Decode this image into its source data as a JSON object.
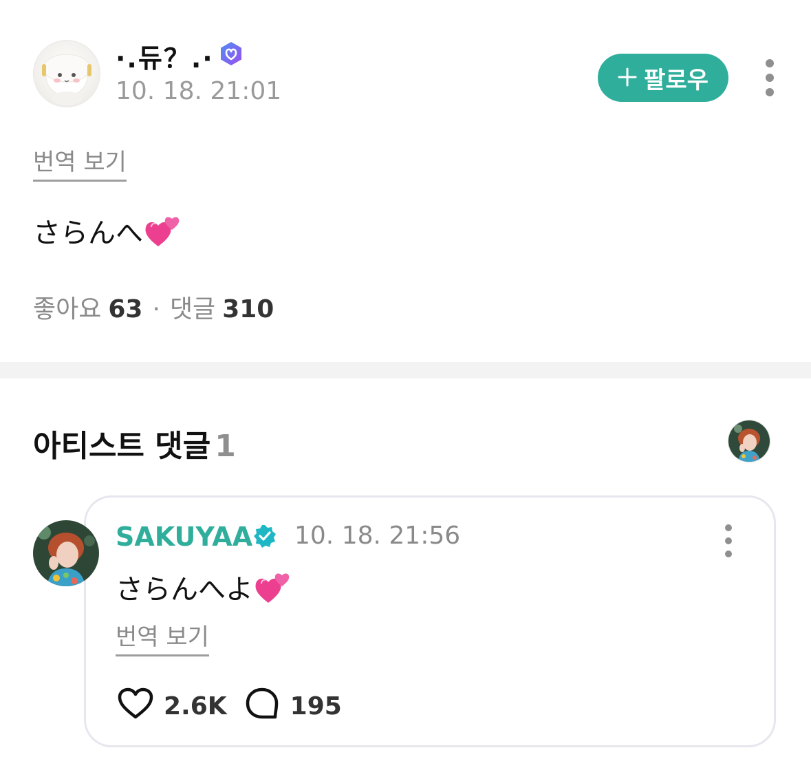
{
  "post": {
    "author": "·.듀？.·",
    "time": "10. 18. 21:01",
    "follow_label": "팔로우",
    "follow_icon": "plus-icon",
    "translate_label": "번역 보기",
    "text": "さらんへ",
    "text_emoji": "two-hearts-emoji",
    "likes_label": "좋아요",
    "likes_count": "63",
    "comments_label": "댓글",
    "comments_count": "310"
  },
  "artist_section": {
    "title": "아티스트 댓글",
    "count": "1"
  },
  "comment": {
    "author": "SAKUYAA",
    "time": "10. 18. 21:56",
    "text": "さらんへよ",
    "text_emoji": "two-hearts-emoji",
    "translate_label": "번역 보기",
    "like_count": "2.6K",
    "reply_count": "195"
  },
  "colors": {
    "accent": "#2fae9c",
    "muted_text": "#8a8a8a",
    "verified_purple": "#7b5cf0",
    "verified_teal": "#1fb7c4"
  }
}
